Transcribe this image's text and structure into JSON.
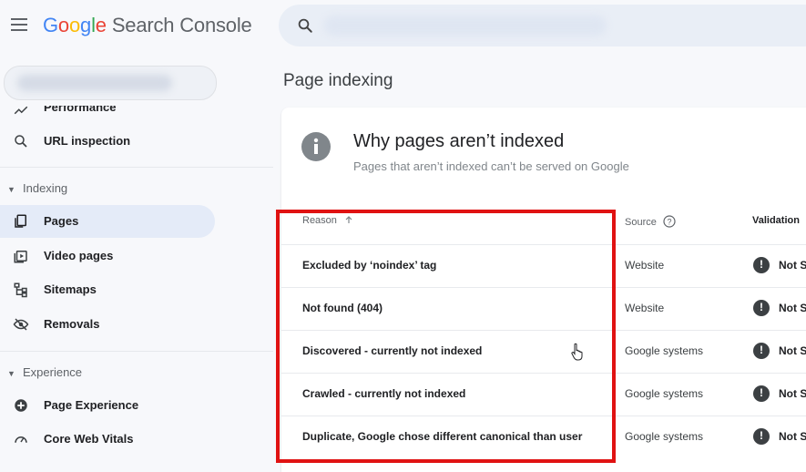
{
  "header": {
    "logo_letters": [
      "G",
      "o",
      "o",
      "g",
      "l",
      "e"
    ],
    "product_name": "Search Console"
  },
  "sidebar": {
    "items_top": [
      {
        "label": "Performance",
        "icon": "trending-up-icon"
      },
      {
        "label": "URL inspection",
        "icon": "search-icon"
      }
    ],
    "sections": [
      {
        "title": "Indexing",
        "items": [
          {
            "label": "Pages",
            "icon": "pages-icon",
            "active": true
          },
          {
            "label": "Video pages",
            "icon": "video-pages-icon"
          },
          {
            "label": "Sitemaps",
            "icon": "sitemap-icon"
          },
          {
            "label": "Removals",
            "icon": "removals-icon"
          }
        ]
      },
      {
        "title": "Experience",
        "items": [
          {
            "label": "Page Experience",
            "icon": "page-experience-icon"
          },
          {
            "label": "Core Web Vitals",
            "icon": "speedometer-icon"
          }
        ]
      }
    ]
  },
  "main": {
    "page_title": "Page indexing",
    "card": {
      "title": "Why pages aren’t indexed",
      "subtitle": "Pages that aren’t indexed can’t be served on Google",
      "columns": {
        "reason": "Reason",
        "source": "Source",
        "validation": "Validation"
      },
      "rows": [
        {
          "reason": "Excluded by ‘noindex’ tag",
          "source": "Website",
          "validation": "Not S"
        },
        {
          "reason": "Not found (404)",
          "source": "Website",
          "validation": "Not S"
        },
        {
          "reason": "Discovered - currently not indexed",
          "source": "Google systems",
          "validation": "Not S"
        },
        {
          "reason": "Crawled - currently not indexed",
          "source": "Google systems",
          "validation": "Not S"
        },
        {
          "reason": "Duplicate, Google chose different canonical than user",
          "source": "Google systems",
          "validation": "Not S"
        }
      ]
    }
  },
  "colors": {
    "highlight": "#e01212",
    "active_nav": "#e4ebf8",
    "google_blue": "#4285f4",
    "google_red": "#ea4335",
    "google_yellow": "#fbbc05",
    "google_green": "#34a853"
  }
}
